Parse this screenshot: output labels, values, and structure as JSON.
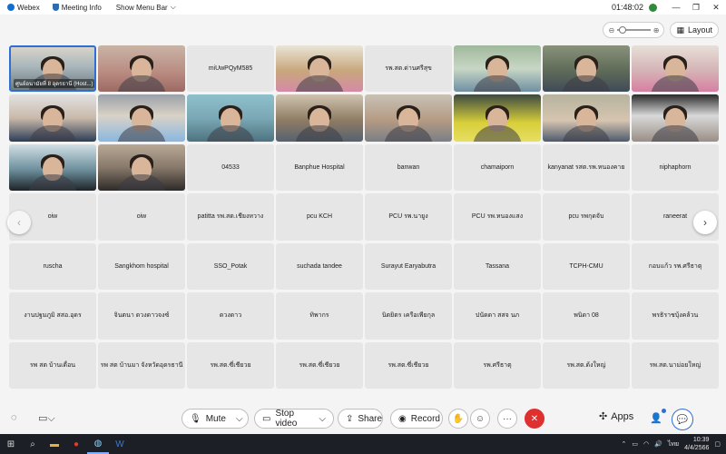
{
  "titlebar": {
    "app_name": "Webex",
    "meeting_info": "Meeting Info",
    "show_menu_bar": "Show Menu Bar",
    "timer": "01:48:02"
  },
  "layout": {
    "label": "Layout"
  },
  "tiles": [
    {
      "type": "video",
      "label": "ศูนย์อนามัยที่ 8 อุดรธานี (Host...)",
      "style": "v1"
    },
    {
      "type": "video",
      "label": "",
      "style": "v2"
    },
    {
      "type": "name",
      "label": "miUwPQyM585"
    },
    {
      "type": "video",
      "label": "",
      "style": "v3"
    },
    {
      "type": "name",
      "label": "รพ.สต.ด่านศรีสุข"
    },
    {
      "type": "video",
      "label": "",
      "style": "v4"
    },
    {
      "type": "video",
      "label": "",
      "style": "v5"
    },
    {
      "type": "video",
      "label": "",
      "style": "v6"
    },
    {
      "type": "video",
      "label": "",
      "style": "v7"
    },
    {
      "type": "video",
      "label": "",
      "style": "v8"
    },
    {
      "type": "video",
      "label": "",
      "style": "v9"
    },
    {
      "type": "video",
      "label": "",
      "style": "v10"
    },
    {
      "type": "video",
      "label": "",
      "style": "v11"
    },
    {
      "type": "video",
      "label": "",
      "style": "v12"
    },
    {
      "type": "video",
      "label": "",
      "style": "v13"
    },
    {
      "type": "video",
      "label": "",
      "style": "v14"
    },
    {
      "type": "video",
      "label": "",
      "style": "v15"
    },
    {
      "type": "video",
      "label": "",
      "style": "v16"
    },
    {
      "type": "name",
      "label": "04533"
    },
    {
      "type": "name",
      "label": "Banphue Hospital"
    },
    {
      "type": "name",
      "label": "banwan"
    },
    {
      "type": "name",
      "label": "chamaiporn"
    },
    {
      "type": "name",
      "label": "kanyanat รสต.รพ.หนองคาย"
    },
    {
      "type": "name",
      "label": "niphaphorn"
    },
    {
      "type": "name",
      "label": "oiw"
    },
    {
      "type": "name",
      "label": "oiw"
    },
    {
      "type": "name",
      "label": "patitta รพ.สต.เชียงหวาง"
    },
    {
      "type": "name",
      "label": "pcu KCH"
    },
    {
      "type": "name",
      "label": "PCU รพ.นายูง"
    },
    {
      "type": "name",
      "label": "PCU รพ.หนองแสง"
    },
    {
      "type": "name",
      "label": "pcu รพกุดจับ"
    },
    {
      "type": "name",
      "label": "raneerat"
    },
    {
      "type": "name",
      "label": "ruscha"
    },
    {
      "type": "name",
      "label": "Sangkhom hospital"
    },
    {
      "type": "name",
      "label": "SSO_Potak"
    },
    {
      "type": "name",
      "label": "suchada tandee"
    },
    {
      "type": "name",
      "label": "Surayut Earyabutra"
    },
    {
      "type": "name",
      "label": "Tassana"
    },
    {
      "type": "name",
      "label": "TCPH-CMU"
    },
    {
      "type": "name",
      "label": "กอบแก้ว รพ.ศรีธาตุ"
    },
    {
      "type": "name",
      "label": "งานปฐมภูมิ สสอ.อุดร"
    },
    {
      "type": "name",
      "label": "จินตนา ดวงดาวจงซ์"
    },
    {
      "type": "name",
      "label": "ดวงดาว"
    },
    {
      "type": "name",
      "label": "ทิพากร"
    },
    {
      "type": "name",
      "label": "นิตยิตร เครือเพียกุล"
    },
    {
      "type": "name",
      "label": "ปนัดดา สสจ นภ"
    },
    {
      "type": "name",
      "label": "พนิดา 08"
    },
    {
      "type": "name",
      "label": "พรธิราชบุ้งคล้วน"
    },
    {
      "type": "name",
      "label": "รพ สต บ้านเดื่อน"
    },
    {
      "type": "name",
      "label": "รพ สต บ้านมา จังหวัดอุดรธานี"
    },
    {
      "type": "name",
      "label": "รพ.สต.ซี่เชียวย"
    },
    {
      "type": "name",
      "label": "รพ.สต.ซี่เชียวย"
    },
    {
      "type": "name",
      "label": "รพ.สต.ซี่เชียวย"
    },
    {
      "type": "name",
      "label": "รพ.ศรีธาตุ"
    },
    {
      "type": "name",
      "label": "รพ.สต.ด้งใหญ่"
    },
    {
      "type": "name",
      "label": "รพ.สต.นาม่อยใหญ่"
    }
  ],
  "controls": {
    "mute": "Mute",
    "stop_video": "Stop video",
    "share": "Share",
    "record": "Record",
    "more": "···",
    "end": "✕",
    "apps": "Apps"
  },
  "taskbar": {
    "time": "10:39",
    "date": "4/4/2566",
    "lang": "ไทย"
  },
  "colors": {
    "accent": "#2e6fd1",
    "end_call": "#e02f2f",
    "active_speaker_border": "#2e6fd1"
  }
}
